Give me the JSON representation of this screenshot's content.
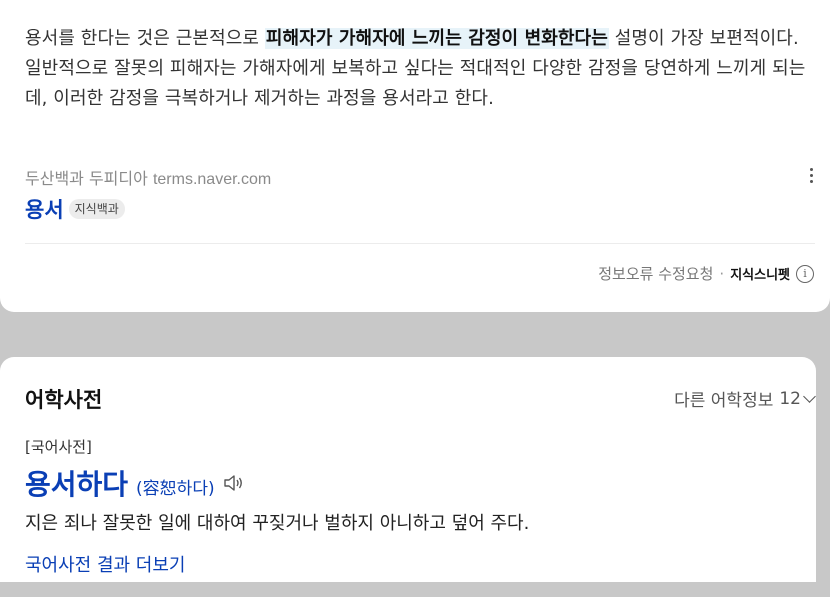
{
  "snippet": {
    "desc_part1": "용서를 한다는 것은 근본적으로 ",
    "desc_highlight": "피해자가 가해자에 느끼는 감정이 변화한다는",
    "desc_part2": " 설명이 가장 보편적이다.",
    "desc_para2": "일반적으로 잘못의 피해자는 가해자에게 보복하고 싶다는 적대적인 다양한 감정을 당연하게 느끼게 되는데, 이러한 감정을 극복하거나 제거하는 과정을 용서라고 한다.",
    "source_name": "두산백과 두피디아",
    "source_domain": "terms.naver.com",
    "entry_title": "용서",
    "entry_badge": "지식백과",
    "report_label": "정보오류 수정요청",
    "separator": "·",
    "snippet_label": "지식스니펫",
    "info_glyph": "i"
  },
  "dictionary": {
    "section_title": "어학사전",
    "other_info_label": "다른 어학정보",
    "other_info_count": "12",
    "dict_name": "[국어사전]",
    "word": "용서하다",
    "hanja": "(容恕하다)",
    "definition": "지은 죄나 잘못한 일에 대하여 꾸짖거나 벌하지 아니하고 덮어 주다.",
    "more_link": "국어사전 결과 더보기"
  },
  "icons": [
    "more-vertical-icon",
    "info-icon",
    "chevron-down-icon",
    "speaker-icon"
  ]
}
